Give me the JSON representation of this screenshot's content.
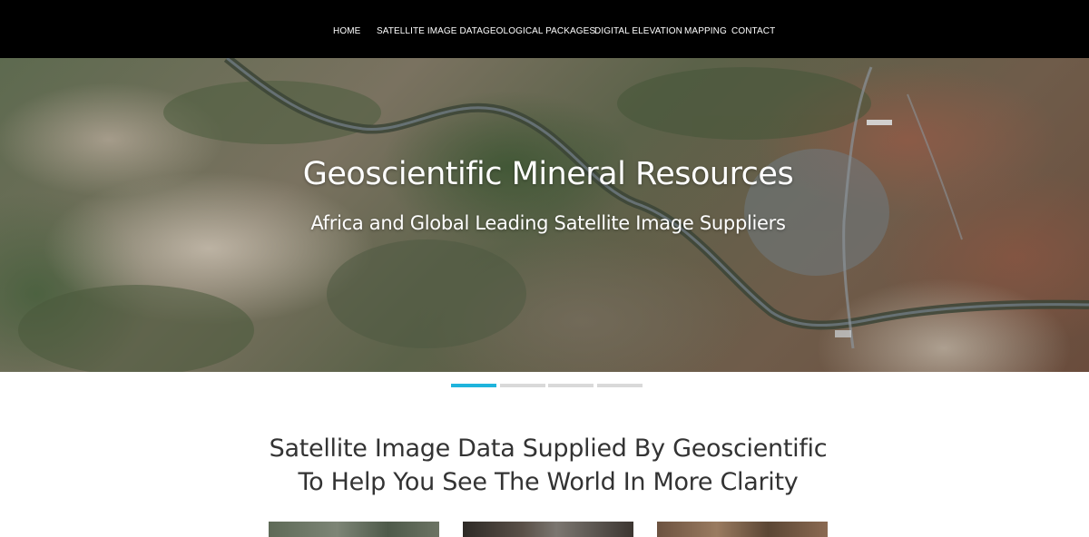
{
  "nav": {
    "items": [
      {
        "label": "HOME"
      },
      {
        "label": "SATELLITE IMAGE DATA"
      },
      {
        "label": "GEOLOGICAL PACKAGES"
      },
      {
        "label": "DIGITAL ELEVATION"
      },
      {
        "label": "MAPPING"
      },
      {
        "label": "CONTACT"
      }
    ]
  },
  "hero": {
    "title": "Geoscientific Mineral Resources",
    "subtitle": "Africa and Global Leading Satellite Image Suppliers"
  },
  "carousel": {
    "slide_count": 4,
    "active_index": 0,
    "active_color": "#1fb4dc",
    "inactive_color": "#d9d9d9"
  },
  "section": {
    "heading_line1": "Satellite Image Data Supplied By Geoscientific",
    "heading_line2": "To Help You See The World In More Clarity"
  },
  "colors": {
    "nav_background": "#000000",
    "text_dark": "#333333"
  }
}
